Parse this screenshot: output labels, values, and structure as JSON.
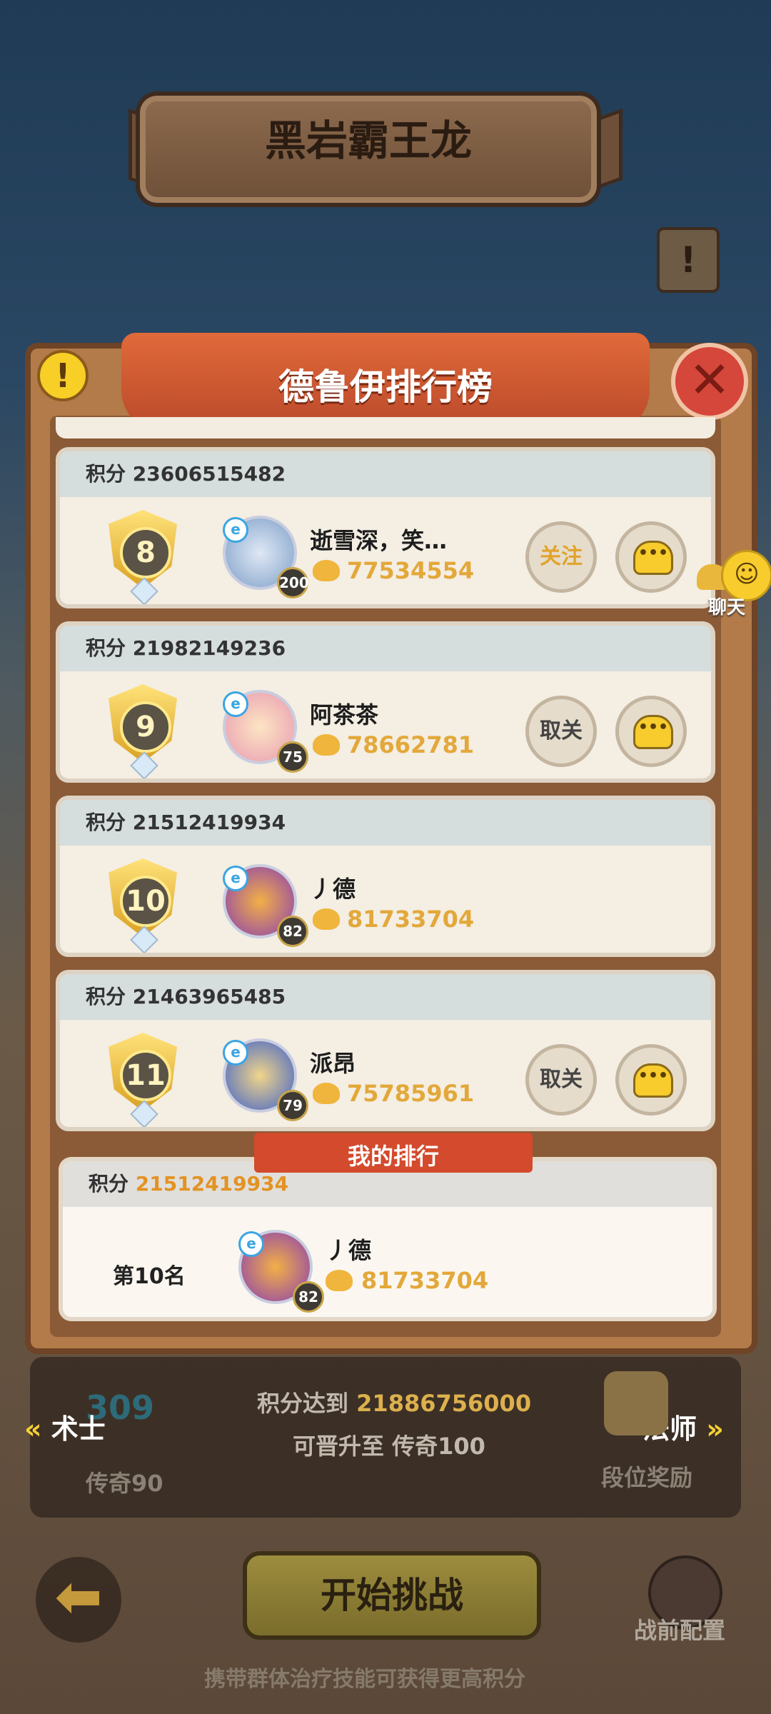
{
  "header": {
    "title": "黑岩霸王龙"
  },
  "panel": {
    "title": "德鲁伊排行榜"
  },
  "labels": {
    "score": "积分",
    "follow": "关注",
    "unfollow": "取关",
    "my_rank_title": "我的排行",
    "chat": "聊天"
  },
  "entries": [
    {
      "rank": "8",
      "score": "23606515482",
      "name": "逝雪深，笑…",
      "level": "200",
      "power": "77534554",
      "action": "关注"
    },
    {
      "rank": "9",
      "score": "21982149236",
      "name": "阿茶茶",
      "level": "75",
      "power": "78662781",
      "action": "取关"
    },
    {
      "rank": "10",
      "score": "21512419934",
      "name": "丿德",
      "level": "82",
      "power": "81733704",
      "action": ""
    },
    {
      "rank": "11",
      "score": "21463965485",
      "name": "派昂",
      "level": "79",
      "power": "75785961",
      "action": "取关"
    }
  ],
  "my": {
    "score": "21512419934",
    "rank_text": "第10名",
    "name": "丿德",
    "level": "82",
    "power": "81733704"
  },
  "progress": {
    "score_prefix": "积分达到",
    "score_target": "21886756000",
    "promote_text": "可晋升至 传奇100",
    "left_class": "术士",
    "right_class": "法师",
    "left_rank": "传奇90",
    "left_rank_number": "309",
    "reward_label": "段位奖励"
  },
  "bottom": {
    "start": "开始挑战",
    "config": "战前配置",
    "hint": "携带群体治疗技能可获得更高积分"
  },
  "colors": {
    "accent": "#e3a83a",
    "ribbon": "#d34a2d",
    "follow": "#e1a42b"
  }
}
